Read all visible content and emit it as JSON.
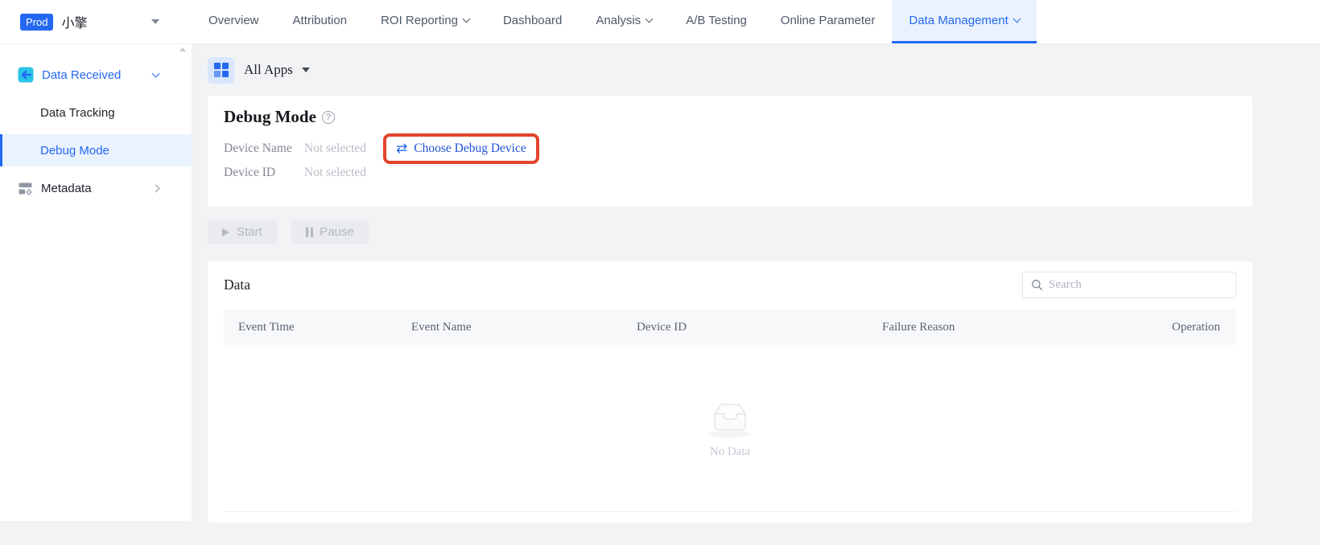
{
  "header": {
    "env_badge": "Prod",
    "app_name": "小擎",
    "nav": [
      {
        "label": "Overview"
      },
      {
        "label": "Attribution"
      },
      {
        "label": "ROI Reporting",
        "has_dropdown": true
      },
      {
        "label": "Dashboard"
      },
      {
        "label": "Analysis",
        "has_dropdown": true
      },
      {
        "label": "A/B Testing"
      },
      {
        "label": "Online Parameter"
      },
      {
        "label": "Data Management",
        "has_dropdown": true,
        "active": true
      }
    ]
  },
  "sidebar": {
    "items": [
      {
        "label": "Data Received",
        "icon": "data-received-icon",
        "chevron": "down",
        "expanded": true
      },
      {
        "label": "Data Tracking",
        "child": true
      },
      {
        "label": "Debug Mode",
        "child": true,
        "active": true
      },
      {
        "label": "Metadata",
        "icon": "metadata-icon",
        "chevron": "right"
      }
    ]
  },
  "app_switcher": {
    "label": "All Apps",
    "icon": "app-grid-icon"
  },
  "debug_panel": {
    "title": "Debug Mode",
    "help_icon": "question-circle-icon",
    "rows": [
      {
        "label": "Device Name",
        "value": "Not selected"
      },
      {
        "label": "Device ID",
        "value": "Not selected"
      }
    ],
    "choose_device_button": {
      "label": "Choose Debug Device",
      "icon": "swap-icon",
      "annotated": true
    }
  },
  "controls": {
    "start_label": "Start",
    "pause_label": "Pause",
    "disabled": true
  },
  "data_panel": {
    "title": "Data",
    "search_placeholder": "Search",
    "columns": [
      "Event Time",
      "Event Name",
      "Device ID",
      "Failure Reason",
      "Operation"
    ],
    "empty_text": "No Data"
  },
  "colors": {
    "accent_blue": "#2468f2",
    "accent_bg": "#eaf2fe",
    "annotation_red": "#e2442b",
    "link_blue": "#2154d4",
    "received_icon_cyan": "#2bc3e8",
    "page_bg": "#f2f3f5"
  }
}
